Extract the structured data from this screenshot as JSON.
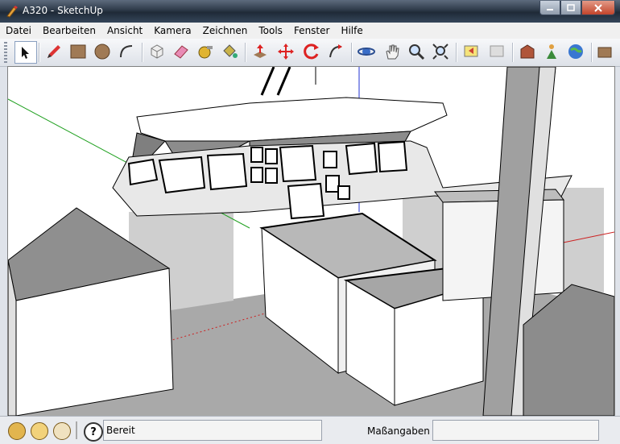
{
  "window": {
    "title": "A320 - SketchUp"
  },
  "menu": [
    "Datei",
    "Bearbeiten",
    "Ansicht",
    "Kamera",
    "Zeichnen",
    "Tools",
    "Fenster",
    "Hilfe"
  ],
  "status": {
    "state_text": "Bereit",
    "measure_label": "Maßangaben",
    "measure_value": ""
  },
  "colors": {
    "axis_red": "#cc2222",
    "axis_green": "#1fa01f",
    "axis_blue": "#2030d0"
  }
}
